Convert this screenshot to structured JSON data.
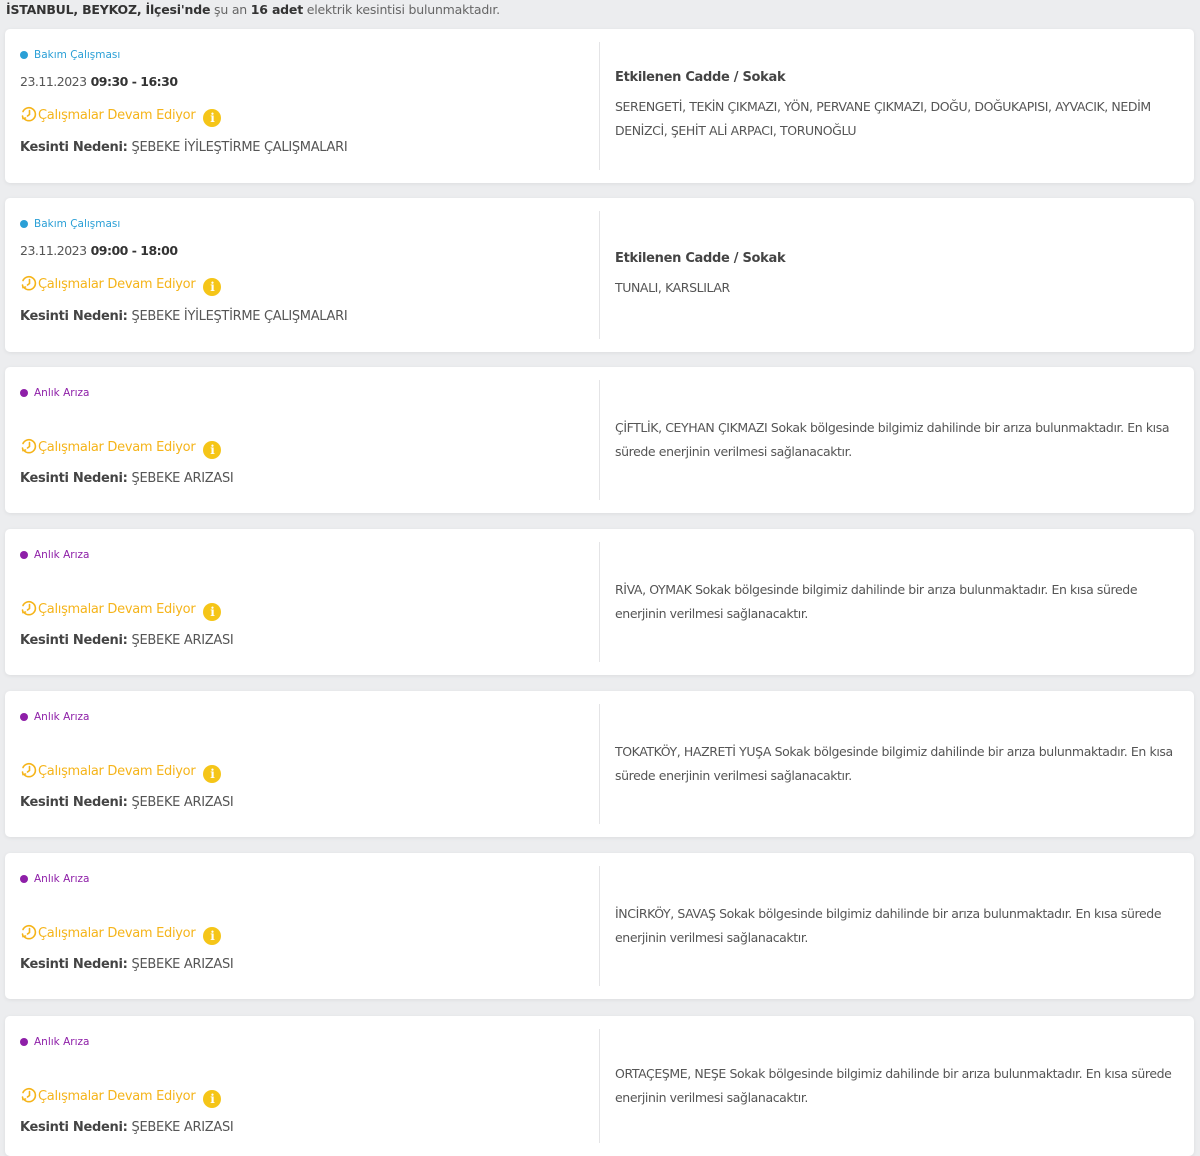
{
  "header": {
    "location": "İSTANBUL, BEYKOZ, İlçesi'nde",
    "middle": "şu an",
    "count": "16 adet",
    "suffix": "elektrik kesintisi bulunmaktadır."
  },
  "colors": {
    "maintenance": "#2a9fd6",
    "fault": "#8e1fa8",
    "status": "#f5b41a",
    "info_badge": "#f5c518"
  },
  "icons": {
    "status": "clock-progress-icon",
    "info": "info-icon"
  },
  "reason_label": "Kesinti Nedeni:",
  "cards": [
    {
      "type": "Bakım Çalışması",
      "date": "23.11.2023",
      "time": "09:30 - 16:30",
      "status": "Çalışmalar Devam Ediyor",
      "reason": "ŞEBEKE İYİLEŞTİRME ÇALIŞMALARI",
      "affected_title": "Etkilenen Cadde / Sokak",
      "affected": "SERENGETİ, TEKİN ÇIKMAZI, YÖN, PERVANE ÇIKMAZI, DOĞU, DOĞUKAPISI, AYVACIK, NEDİM DENİZCİ, ŞEHİT ALİ ARPACI, TORUNOĞLU"
    },
    {
      "type": "Bakım Çalışması",
      "date": "23.11.2023",
      "time": "09:00 - 18:00",
      "status": "Çalışmalar Devam Ediyor",
      "reason": "ŞEBEKE İYİLEŞTİRME ÇALIŞMALARI",
      "affected_title": "Etkilenen Cadde / Sokak",
      "affected": "TUNALI, KARSLILAR"
    },
    {
      "type": "Anlık Arıza",
      "status": "Çalışmalar Devam Ediyor",
      "reason": "ŞEBEKE ARIZASI",
      "affected": "ÇİFTLİK, CEYHAN ÇIKMAZI Sokak bölgesinde bilgimiz dahilinde bir arıza bulunmaktadır. En kısa sürede enerjinin verilmesi sağlanacaktır."
    },
    {
      "type": "Anlık Arıza",
      "status": "Çalışmalar Devam Ediyor",
      "reason": "ŞEBEKE ARIZASI",
      "affected": "RİVA, OYMAK Sokak bölgesinde bilgimiz dahilinde bir arıza bulunmaktadır. En kısa sürede enerjinin verilmesi sağlanacaktır."
    },
    {
      "type": "Anlık Arıza",
      "status": "Çalışmalar Devam Ediyor",
      "reason": "ŞEBEKE ARIZASI",
      "affected": "TOKATKÖY, HAZRETİ YUŞA Sokak bölgesinde bilgimiz dahilinde bir arıza bulunmaktadır. En kısa sürede enerjinin verilmesi sağlanacaktır."
    },
    {
      "type": "Anlık Arıza",
      "status": "Çalışmalar Devam Ediyor",
      "reason": "ŞEBEKE ARIZASI",
      "affected": "İNCİRKÖY, SAVAŞ Sokak bölgesinde bilgimiz dahilinde bir arıza bulunmaktadır. En kısa sürede enerjinin verilmesi sağlanacaktır."
    },
    {
      "type": "Anlık Arıza",
      "status": "Çalışmalar Devam Ediyor",
      "reason": "ŞEBEKE ARIZASI",
      "affected": "ORTAÇEŞME, NEŞE Sokak bölgesinde bilgimiz dahilinde bir arıza bulunmaktadır. En kısa sürede enerjinin verilmesi sağlanacaktır."
    }
  ]
}
